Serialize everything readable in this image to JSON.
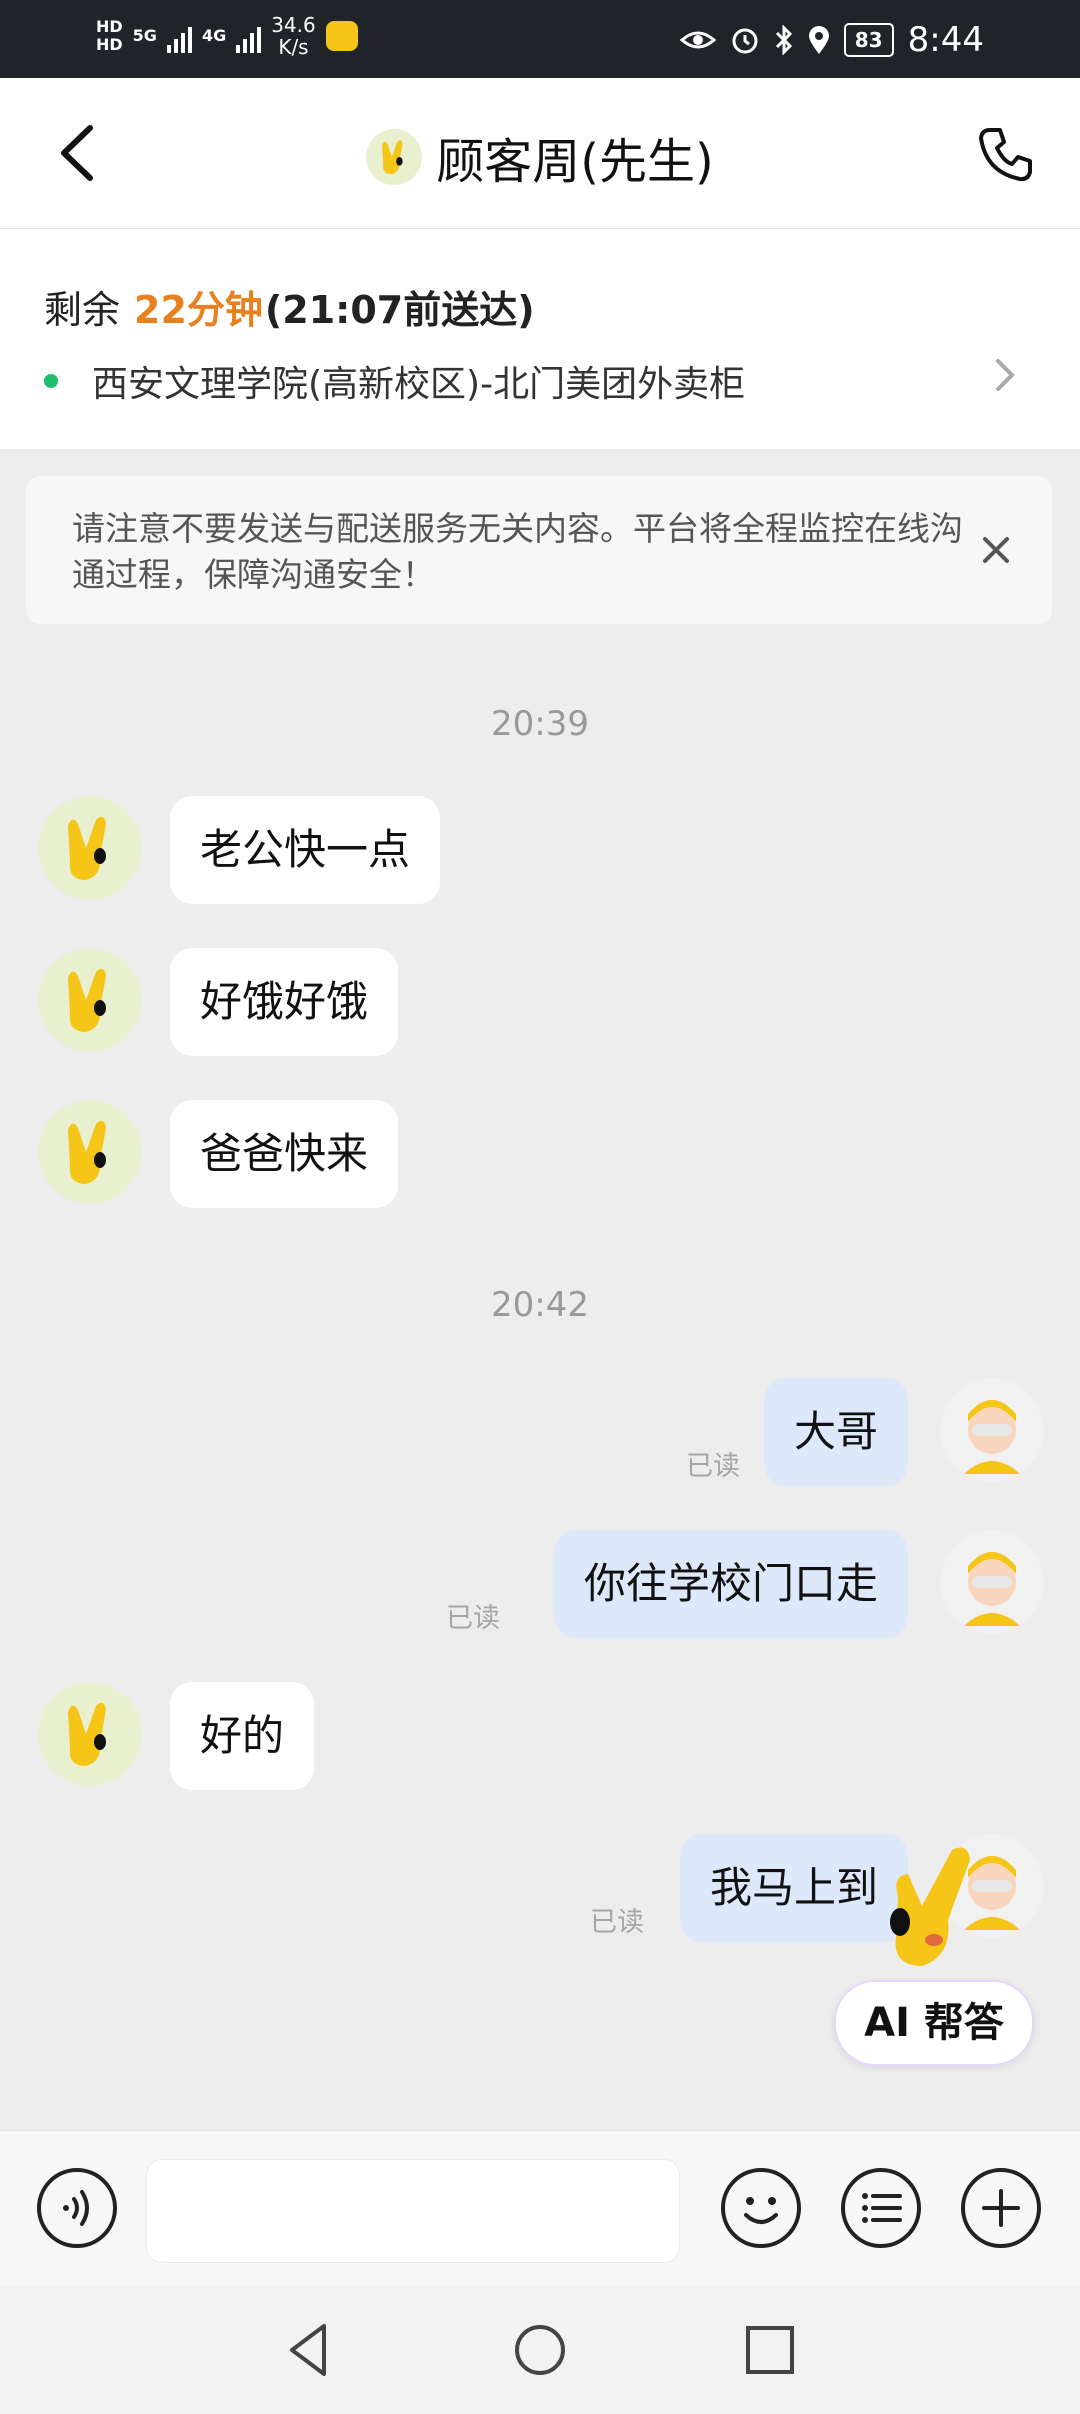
{
  "status_bar": {
    "hd1": "HD",
    "hd2": "HD",
    "net1": "5G",
    "net2": "4G",
    "speed": "34.6",
    "speed_unit": "K/s",
    "battery": "83",
    "time": "8:44"
  },
  "header": {
    "title": "顾客周(先生)"
  },
  "order": {
    "remaining_prefix": "剩余",
    "remaining_time": "22分钟",
    "eta": "(21:07前送达)",
    "address": "西安文理学院(高新校区)-北门美团外卖柜"
  },
  "notice": {
    "text": "请注意不要发送与配送服务无关内容。平台将全程监控在线沟通过程，保障沟通安全！"
  },
  "chat": {
    "timestamps": [
      "20:39",
      "20:42"
    ],
    "messages": [
      {
        "side": "left",
        "text": "老公快一点"
      },
      {
        "side": "left",
        "text": "好饿好饿"
      },
      {
        "side": "left",
        "text": "爸爸快来"
      },
      {
        "side": "right",
        "text": "大哥",
        "status": "已读"
      },
      {
        "side": "right",
        "text": "你往学校门口走",
        "status": "已读"
      },
      {
        "side": "left",
        "text": "好的"
      },
      {
        "side": "right",
        "text": "我马上到",
        "status": "已读"
      }
    ]
  },
  "ai_button": {
    "label": "AI 帮答"
  },
  "input": {
    "placeholder": ""
  },
  "colors": {
    "accent_orange": "#e8801e",
    "status_green": "#1fbf6a",
    "bubble_right": "#dde9fb",
    "mascot_yellow": "#f5c518"
  }
}
